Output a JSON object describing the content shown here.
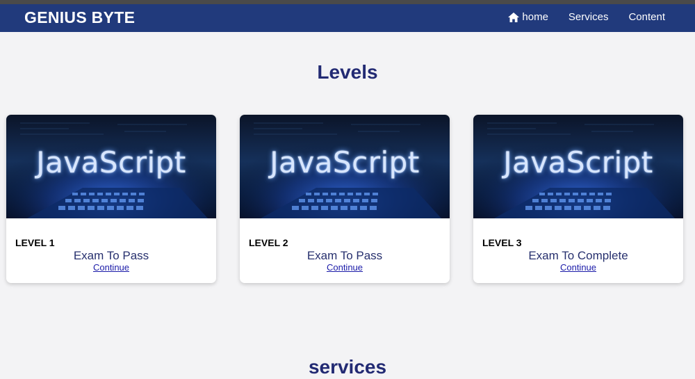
{
  "header": {
    "brand": "GENIUS BYTE",
    "nav": [
      {
        "label": "home",
        "icon": "home-icon"
      },
      {
        "label": "Services"
      },
      {
        "label": "Content"
      }
    ]
  },
  "levels": {
    "title": "Levels",
    "cards": [
      {
        "image_text": "JavaScript",
        "level": "LEVEL 1",
        "description": "Exam To Pass",
        "link": "Continue"
      },
      {
        "image_text": "JavaScript",
        "level": "LEVEL 2",
        "description": "Exam To Pass",
        "link": "Continue"
      },
      {
        "image_text": "JavaScript",
        "level": "LEVEL 3",
        "description": "Exam To Complete",
        "link": "Continue"
      }
    ]
  },
  "services": {
    "title": "services"
  },
  "colors": {
    "navbar": "#213a7c",
    "heading": "#222a73",
    "background": "#f3f3f5"
  }
}
